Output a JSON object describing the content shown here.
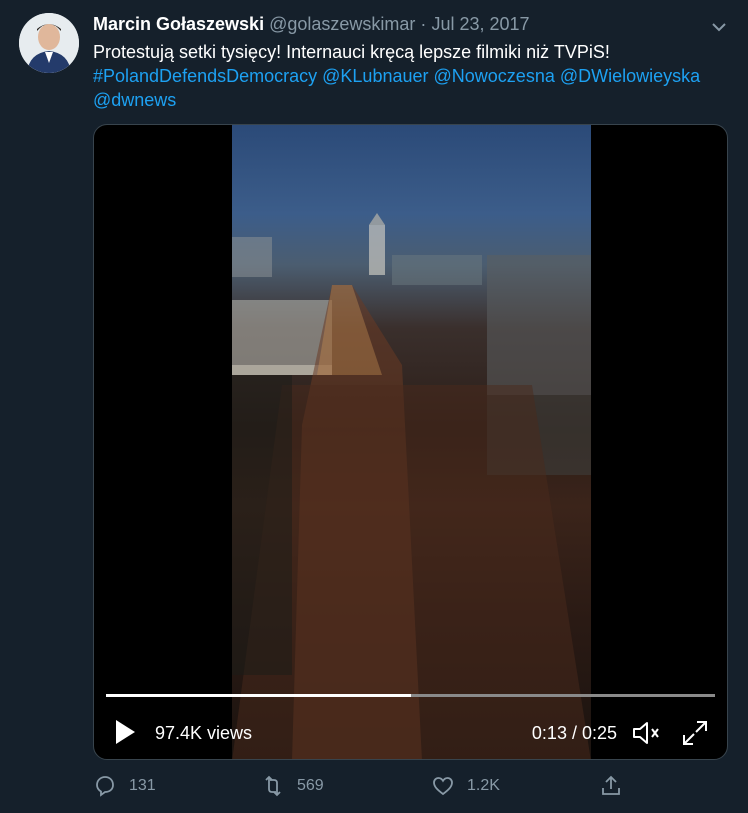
{
  "tweet": {
    "author_name": "Marcin Gołaszewski",
    "handle": "@golaszewskimar",
    "separator": "·",
    "date": "Jul 23, 2017",
    "text_plain": "Protestują setki tysięcy! Internauci kręcą lepsze filmiki niż TVPiS!",
    "links": [
      "#PolandDefendsDemocracy",
      "@KLubnauer",
      "@Nowoczesna",
      "@DWielowieyska",
      "@dwnews"
    ]
  },
  "video": {
    "views": "97.4K views",
    "time": "0:13 / 0:25",
    "progress": 0.5
  },
  "actions": {
    "reply_count": "131",
    "retweet_count": "569",
    "like_count": "1.2K"
  },
  "icons": {
    "caret": "chevron-down-icon",
    "play": "play-icon",
    "volume": "volume-icon",
    "fullscreen": "fullscreen-icon",
    "reply": "reply-icon",
    "retweet": "retweet-icon",
    "like": "like-icon",
    "share": "share-icon"
  },
  "colors": {
    "background": "#15202b",
    "link": "#1da1f2",
    "muted": "#8899a6"
  }
}
